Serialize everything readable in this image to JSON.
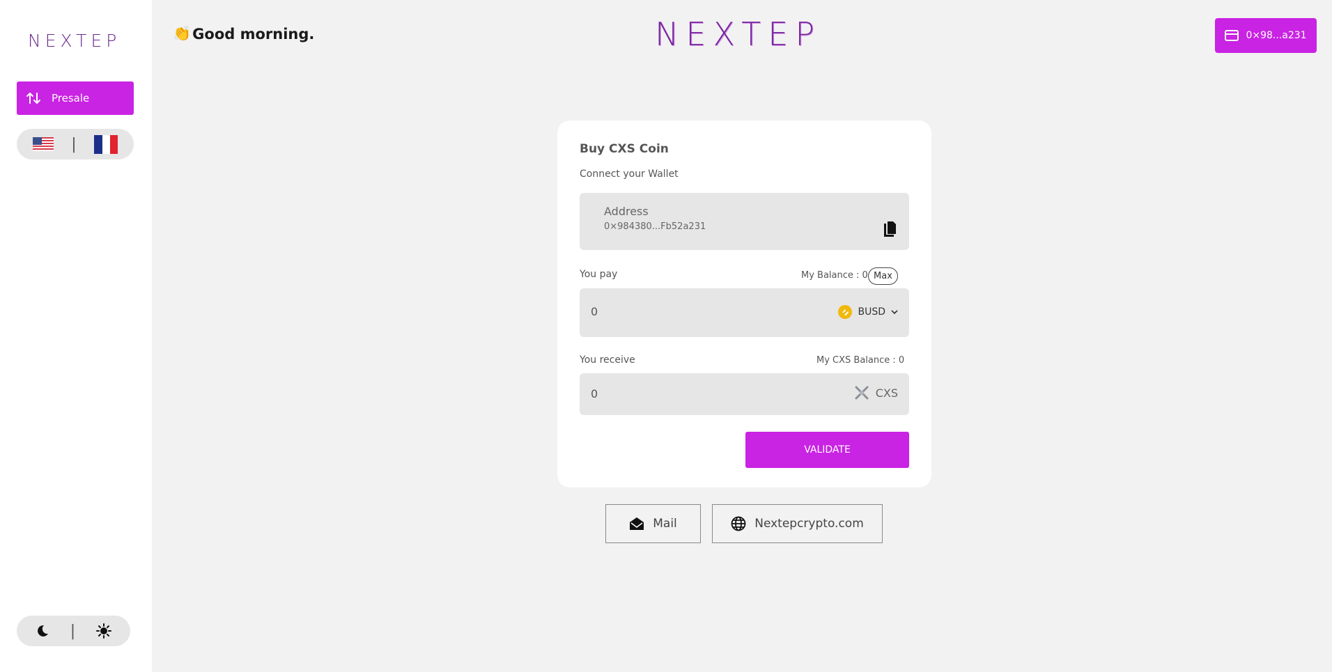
{
  "sidebar": {
    "logo": "NEXTEP",
    "presale_label": "Presale",
    "lang_separator": "|",
    "theme_separator": "|"
  },
  "header": {
    "greeting_emoji": "👏",
    "greeting": "Good morning.",
    "logo": "NEXTEP",
    "wallet_label": "0×98...a231"
  },
  "card": {
    "title": "Buy CXS Coin",
    "subtitle": "Connect your Wallet",
    "address_label": "Address",
    "address_value": "0×984380...Fb52a231",
    "pay_label": "You pay",
    "pay_balance": "My Balance : 0",
    "max_label": "Max",
    "pay_value": "0",
    "pay_token": "BUSD",
    "receive_label": "You receive",
    "receive_balance": "My CXS Balance : 0",
    "receive_value": "0",
    "receive_token": "CXS",
    "validate_label": "VALIDATE"
  },
  "links": {
    "mail_label": "Mail",
    "site_label": "Nextepcrypto.com"
  },
  "colors": {
    "accent": "#c923e3",
    "background": "#f2f2f2",
    "input_bg": "#e6e6e6",
    "busd": "#f0b90b"
  }
}
